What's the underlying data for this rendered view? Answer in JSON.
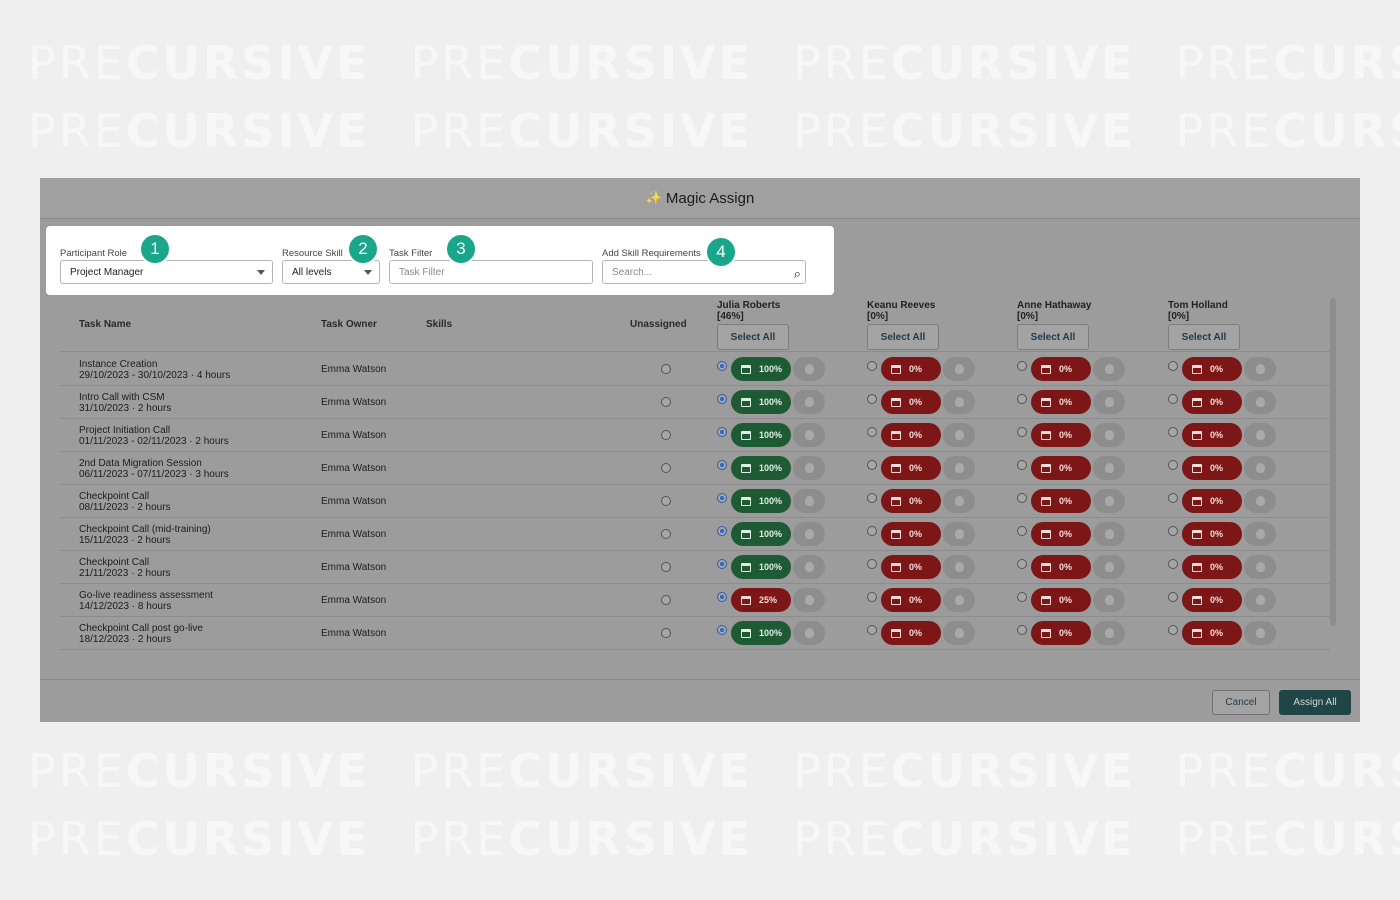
{
  "watermark": {
    "light": "PRE",
    "bold": "CURSIVE"
  },
  "modal": {
    "title": "Magic Assign",
    "sparkle_icon": "sparkle-icon"
  },
  "filters": {
    "participant_role": {
      "label": "Participant Role",
      "value": "Project Manager"
    },
    "resource_skill": {
      "label": "Resource Skill",
      "value": "All levels"
    },
    "task_filter": {
      "label": "Task Filter",
      "placeholder": "Task Filter"
    },
    "skill_requirements": {
      "label": "Add Skill Requirements",
      "placeholder": "Search..."
    },
    "badges": [
      "1",
      "2",
      "3",
      "4"
    ]
  },
  "table": {
    "headers": {
      "task_name": "Task Name",
      "task_owner": "Task Owner",
      "skills": "Skills",
      "unassigned": "Unassigned"
    },
    "resources": [
      {
        "name": "Julia Roberts",
        "percent": "[46%]",
        "select_all": "Select All"
      },
      {
        "name": "Keanu Reeves",
        "percent": "[0%]",
        "select_all": "Select All"
      },
      {
        "name": "Anne Hathaway",
        "percent": "[0%]",
        "select_all": "Select All"
      },
      {
        "name": "Tom Holland",
        "percent": "[0%]",
        "select_all": "Select All"
      }
    ],
    "rows": [
      {
        "name": "Instance Creation",
        "meta": "29/10/2023 - 30/10/2023 · 4 hours",
        "owner": "Emma Watson",
        "julia": "100%",
        "julia_status": "green",
        "others": "0%"
      },
      {
        "name": "Intro Call with CSM",
        "meta": "31/10/2023 · 2 hours",
        "owner": "Emma Watson",
        "julia": "100%",
        "julia_status": "green",
        "others": "0%"
      },
      {
        "name": "Project Initiation Call",
        "meta": "01/11/2023 - 02/11/2023 · 2 hours",
        "owner": "Emma Watson",
        "julia": "100%",
        "julia_status": "green",
        "others": "0%"
      },
      {
        "name": "2nd Data Migration Session",
        "meta": "06/11/2023 - 07/11/2023 · 3 hours",
        "owner": "Emma Watson",
        "julia": "100%",
        "julia_status": "green",
        "others": "0%"
      },
      {
        "name": "Checkpoint Call",
        "meta": "08/11/2023 · 2 hours",
        "owner": "Emma Watson",
        "julia": "100%",
        "julia_status": "green",
        "others": "0%"
      },
      {
        "name": "Checkpoint Call (mid-training)",
        "meta": "15/11/2023 · 2 hours",
        "owner": "Emma Watson",
        "julia": "100%",
        "julia_status": "green",
        "others": "0%"
      },
      {
        "name": "Checkpoint Call",
        "meta": "21/11/2023 · 2 hours",
        "owner": "Emma Watson",
        "julia": "100%",
        "julia_status": "green",
        "others": "0%"
      },
      {
        "name": "Go-live readiness assessment",
        "meta": "14/12/2023 · 8 hours",
        "owner": "Emma Watson",
        "julia": "25%",
        "julia_status": "red",
        "others": "0%"
      },
      {
        "name": "Checkpoint Call post go-live",
        "meta": "18/12/2023 · 2 hours",
        "owner": "Emma Watson",
        "julia": "100%",
        "julia_status": "green",
        "others": "0%"
      }
    ]
  },
  "footer": {
    "cancel": "Cancel",
    "assign_all": "Assign All"
  },
  "colors": {
    "badge": "#19a68a",
    "available": "#1e5b35",
    "unavailable": "#7d1616",
    "primary_button": "#1f4547"
  }
}
